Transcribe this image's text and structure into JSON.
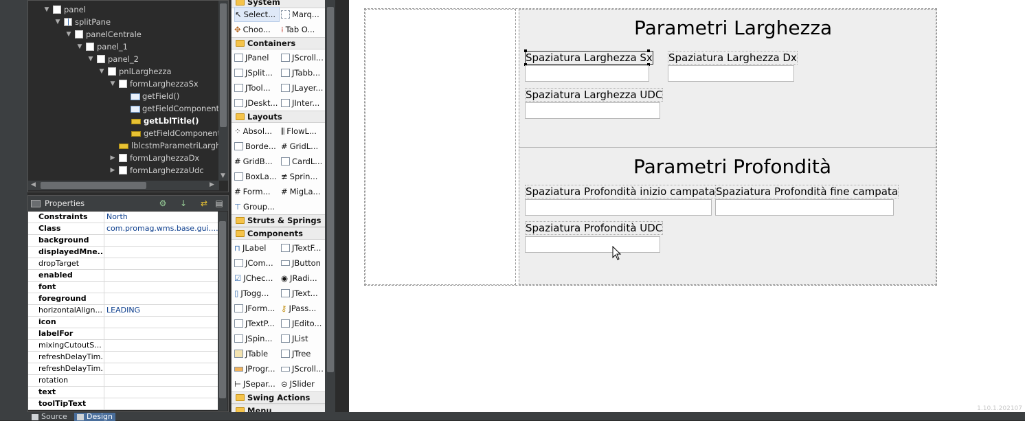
{
  "tree": {
    "items": [
      {
        "label": "panel"
      },
      {
        "label": "splitPane"
      },
      {
        "label": "panelCentrale"
      },
      {
        "label": "panel_1"
      },
      {
        "label": "panel_2"
      },
      {
        "label": "pnlLarghezza"
      },
      {
        "label": "formLarghezzaSx"
      },
      {
        "label": "getField()"
      },
      {
        "label": "getFieldComponent"
      },
      {
        "label": "getLblTitle()"
      },
      {
        "label": "getFieldComponent"
      },
      {
        "label": "lblcstmParametriLarghe"
      },
      {
        "label": "formLarghezzaDx"
      },
      {
        "label": "formLarghezzaUdc"
      }
    ]
  },
  "properties": {
    "title": "Properties",
    "rows": [
      {
        "name": "Constraints",
        "value": "North"
      },
      {
        "name": "Class",
        "value": "com.promag.wms.base.gui...."
      },
      {
        "name": "background",
        "value": ""
      },
      {
        "name": "displayedMne...",
        "value": ""
      },
      {
        "name": "dropTarget",
        "value": ""
      },
      {
        "name": "enabled",
        "value": ""
      },
      {
        "name": "font",
        "value": ""
      },
      {
        "name": "foreground",
        "value": ""
      },
      {
        "name": "horizontalAlign...",
        "value": "LEADING"
      },
      {
        "name": "icon",
        "value": ""
      },
      {
        "name": "labelFor",
        "value": ""
      },
      {
        "name": "mixingCutoutS...",
        "value": ""
      },
      {
        "name": "refreshDelayTim...",
        "value": ""
      },
      {
        "name": "refreshDelayTim...",
        "value": ""
      },
      {
        "name": "rotation",
        "value": ""
      },
      {
        "name": "text",
        "value": ""
      },
      {
        "name": "toolTipText",
        "value": ""
      }
    ]
  },
  "palette": {
    "categories": {
      "system": "System",
      "containers": "Containers",
      "layouts": "Layouts",
      "struts": "Struts & Springs",
      "components": "Components",
      "swing_actions": "Swing Actions",
      "menu": "Menu"
    },
    "items": [
      "Select...",
      "Marq...",
      "Choo...",
      "Tab O...",
      "JPanel",
      "JScroll...",
      "JSplit...",
      "JTabb...",
      "JTool...",
      "JLayer...",
      "JDeskt...",
      "JInter...",
      "Absol...",
      "FlowL...",
      "Borde...",
      "GridL...",
      "GridB...",
      "CardL...",
      "BoxLa...",
      "Sprin...",
      "Form...",
      "MigLa...",
      "Group...",
      "JLabel",
      "JTextF...",
      "JCom...",
      "JButton",
      "JChec...",
      "JRadi...",
      "JTogg...",
      "JText...",
      "JForm...",
      "JPass...",
      "JTextP...",
      "JEdito...",
      "JSpin...",
      "JList",
      "JTable",
      "JTree",
      "JProgr...",
      "JScroll...",
      "JSepar...",
      "JSlider"
    ]
  },
  "design": {
    "larghezza_title": "Parametri Larghezza",
    "profondita_title": "Parametri Profondità",
    "fields": {
      "larghezza_sx": "Spaziatura Larghezza Sx",
      "larghezza_dx": "Spaziatura Larghezza Dx",
      "larghezza_udc": "Spaziatura Larghezza UDC",
      "profondita_inizio": "Spaziatura Profondità inizio campata",
      "profondita_fine": "Spaziatura Profondità fine campata",
      "profondita_udc": "Spaziatura Profondità UDC"
    },
    "watermark": "1.10.1.202107"
  },
  "bottom_tabs": {
    "source": "Source",
    "design": "Design"
  }
}
